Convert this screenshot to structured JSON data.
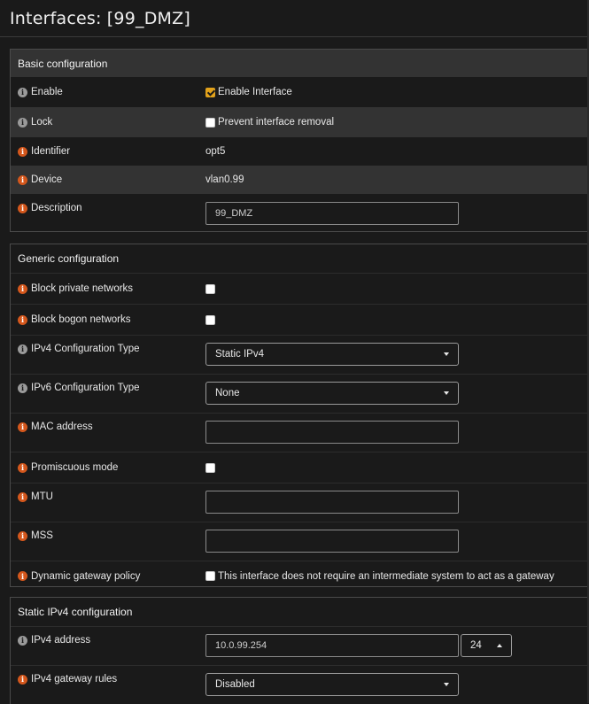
{
  "page": {
    "title": "Interfaces: [99_DMZ]"
  },
  "basic": {
    "title": "Basic configuration",
    "enable": {
      "label": "Enable",
      "checkbox_label": "Enable Interface",
      "checked": true
    },
    "lock": {
      "label": "Lock",
      "checkbox_label": "Prevent interface removal",
      "checked": false
    },
    "identifier": {
      "label": "Identifier",
      "value": "opt5"
    },
    "device": {
      "label": "Device",
      "value": "vlan0.99"
    },
    "description": {
      "label": "Description",
      "value": "99_DMZ"
    }
  },
  "generic": {
    "title": "Generic configuration",
    "block_private": {
      "label": "Block private networks",
      "checked": false
    },
    "block_bogon": {
      "label": "Block bogon networks",
      "checked": false
    },
    "ipv4_type": {
      "label": "IPv4 Configuration Type",
      "selected": "Static IPv4"
    },
    "ipv6_type": {
      "label": "IPv6 Configuration Type",
      "selected": "None"
    },
    "mac": {
      "label": "MAC address",
      "value": ""
    },
    "promiscuous": {
      "label": "Promiscuous mode",
      "checked": false
    },
    "mtu": {
      "label": "MTU",
      "value": ""
    },
    "mss": {
      "label": "MSS",
      "value": ""
    },
    "gateway_policy": {
      "label": "Dynamic gateway policy",
      "checkbox_label": "This interface does not require an intermediate system to act as a gateway",
      "checked": false
    }
  },
  "static_ipv4": {
    "title": "Static IPv4 configuration",
    "address": {
      "label": "IPv4 address",
      "value": "10.0.99.254",
      "mask": "24"
    },
    "gateway_rules": {
      "label": "IPv4 gateway rules",
      "selected": "Disabled"
    }
  },
  "colors": {
    "accent_checkbox": "#e2a21b",
    "info_orange": "#d4571c",
    "info_grey": "#9a9a9a",
    "row_stripe": "#333333"
  }
}
